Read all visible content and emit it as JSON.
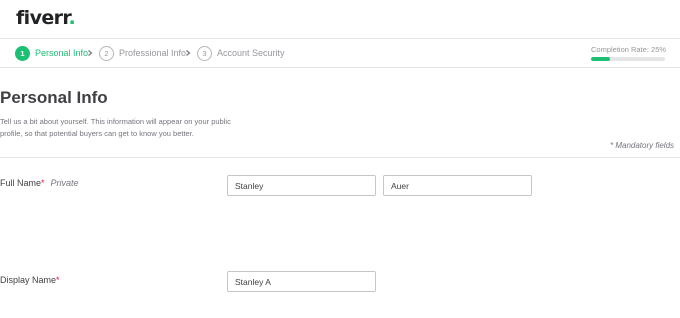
{
  "brand": {
    "logo_text": "fiverr",
    "logo_dot": ".",
    "accent_color": "#1dbf73",
    "required_color": "#e0173d"
  },
  "steps": [
    {
      "number": "1",
      "label": "Personal Info",
      "state": "active"
    },
    {
      "number": "2",
      "label": "Professional Info",
      "state": "idle"
    },
    {
      "number": "3",
      "label": "Account Security",
      "state": "idle"
    }
  ],
  "completion": {
    "label": "Completion Rate: 25%",
    "percent": 25
  },
  "page": {
    "title": "Personal Info",
    "intro": "Tell us a bit about yourself. This information will appear on your public profile, so that potential buyers can get to know you better.",
    "mandatory_note": "* Mandatory fields"
  },
  "form": {
    "full_name": {
      "label": "Full Name",
      "required_mark": "*",
      "private_tag": "Private",
      "first_value": "Stanley",
      "last_value": "Auer"
    },
    "display_name": {
      "label": "Display Name",
      "required_mark": "*",
      "value": "Stanley A"
    }
  },
  "icons": {
    "step_separator": "chevron-right-icon"
  }
}
